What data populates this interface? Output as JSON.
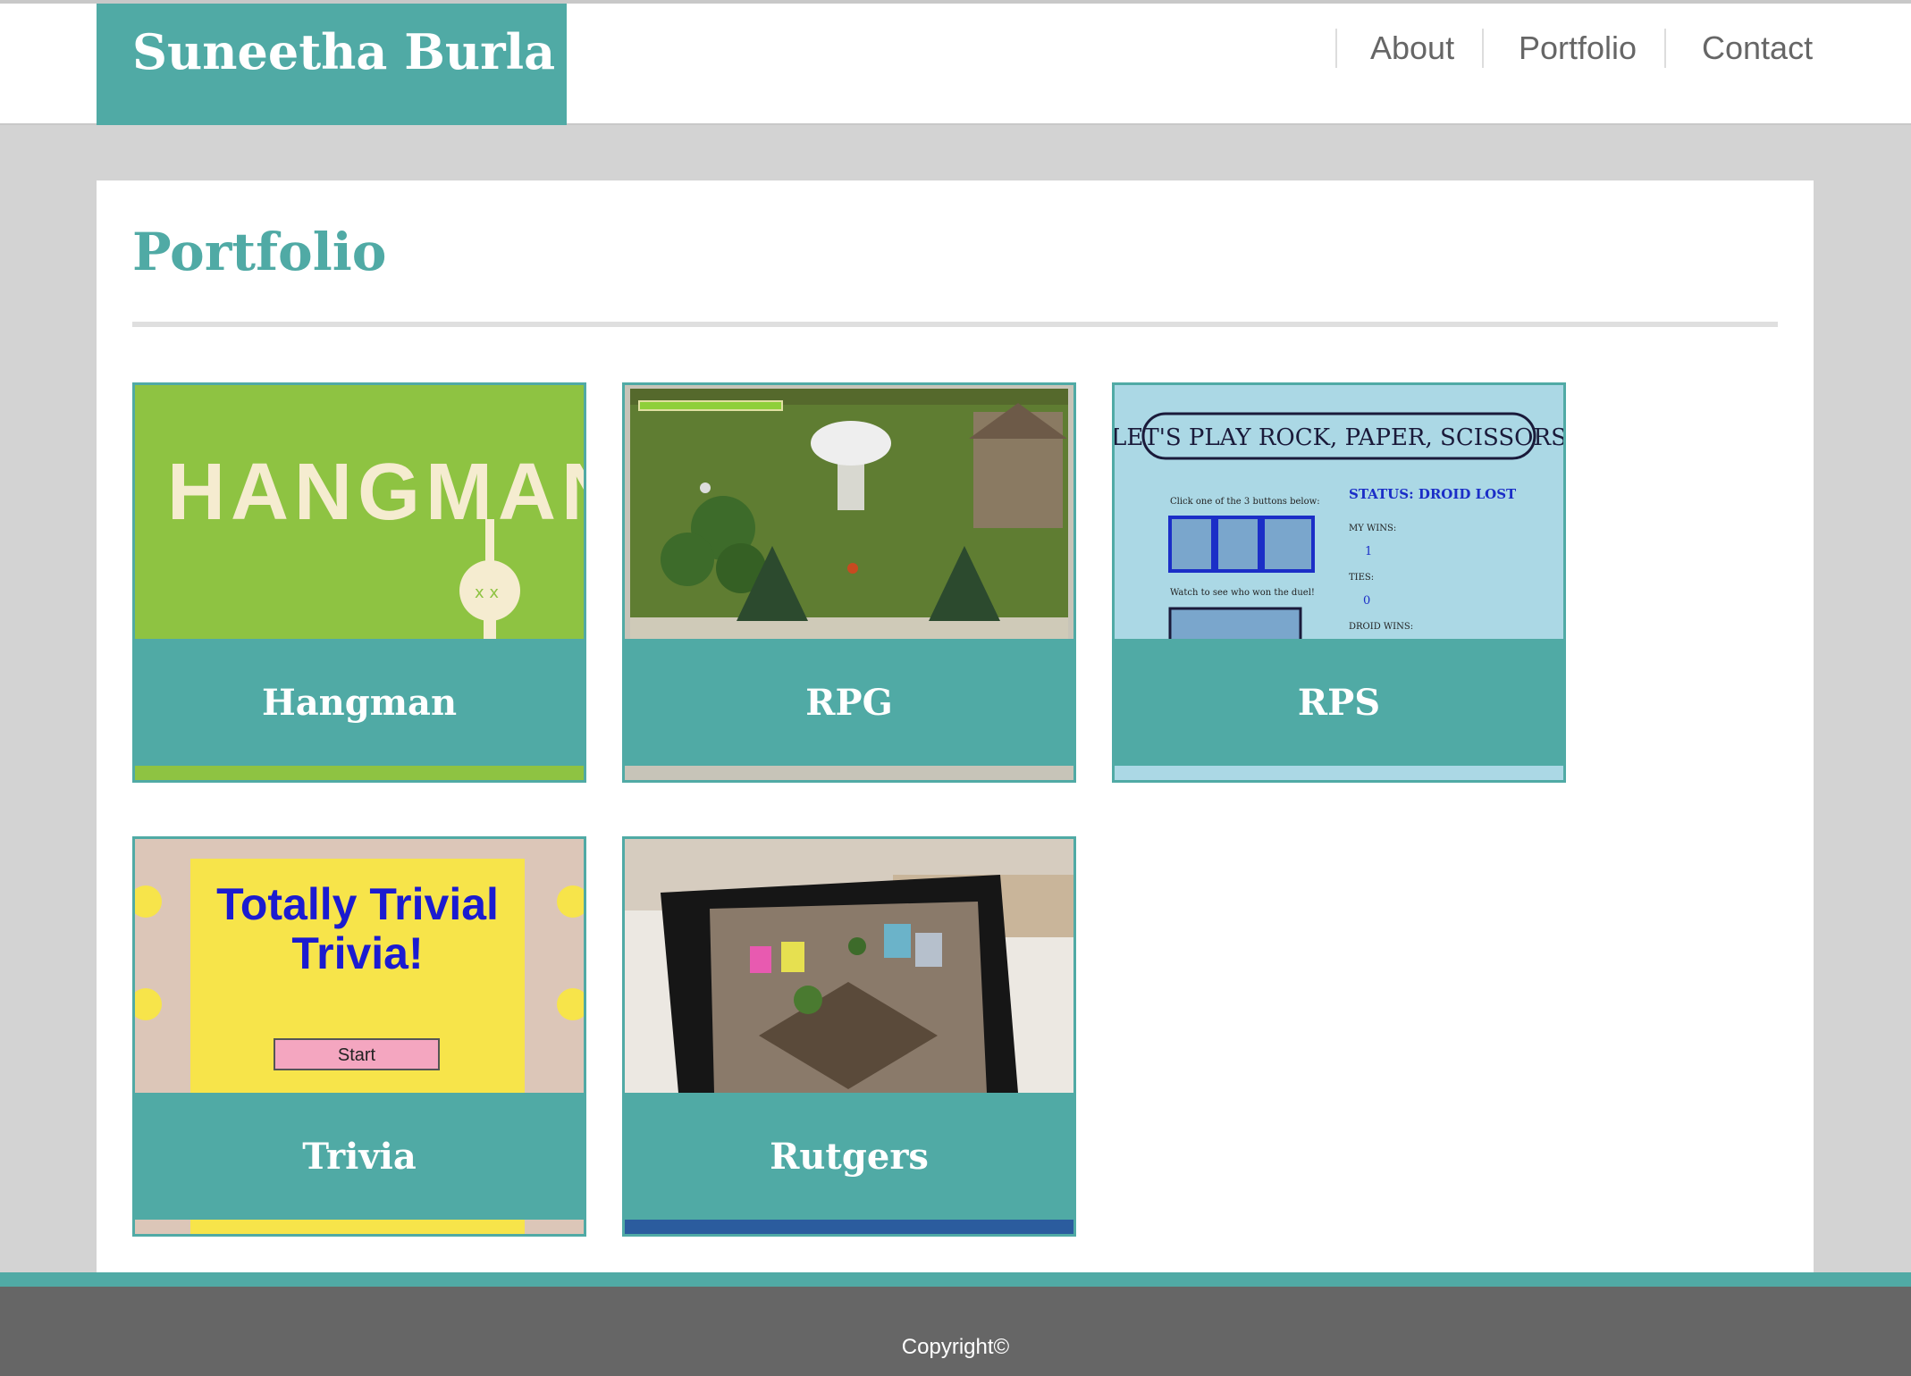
{
  "header": {
    "brand": "Suneetha Burla",
    "nav": [
      {
        "label": "About"
      },
      {
        "label": "Portfolio"
      },
      {
        "label": "Contact"
      }
    ]
  },
  "main": {
    "title": "Portfolio",
    "projects": [
      {
        "name": "Hangman",
        "thumbnail": {
          "title": "HANGMAN",
          "background": "#8ec342",
          "icon": "hangman-face-icon"
        }
      },
      {
        "name": "RPG",
        "thumbnail": {
          "description_icon": "rpg-game-scene",
          "background": "#5f7d32"
        }
      },
      {
        "name": "RPS",
        "thumbnail": {
          "heading": "LET'S PLAY ROCK, PAPER, SCISSORS",
          "status": "STATUS: DROID LOST",
          "instruction": "Click one of the 3 buttons below:",
          "watch": "Watch to see who won the duel!",
          "my_wins_label": "MY WINS:",
          "my_wins": "1",
          "ties_label": "TIES:",
          "ties": "0",
          "droid_wins_label": "DROID WINS:",
          "background": "#abd8e5"
        }
      },
      {
        "name": "Trivia",
        "thumbnail": {
          "title_line1": "Totally Trivial",
          "title_line2": "Trivia!",
          "button": "Start",
          "background": "#f7e44a"
        }
      },
      {
        "name": "Rutgers",
        "thumbnail": {
          "description_icon": "tablet-village-scene",
          "background": "#ece8e2"
        }
      }
    ]
  },
  "footer": {
    "copyright": "Copyright©"
  },
  "colors": {
    "accent": "#50aaa5",
    "footer": "#666666",
    "page_bg": "#d3d3d3"
  }
}
